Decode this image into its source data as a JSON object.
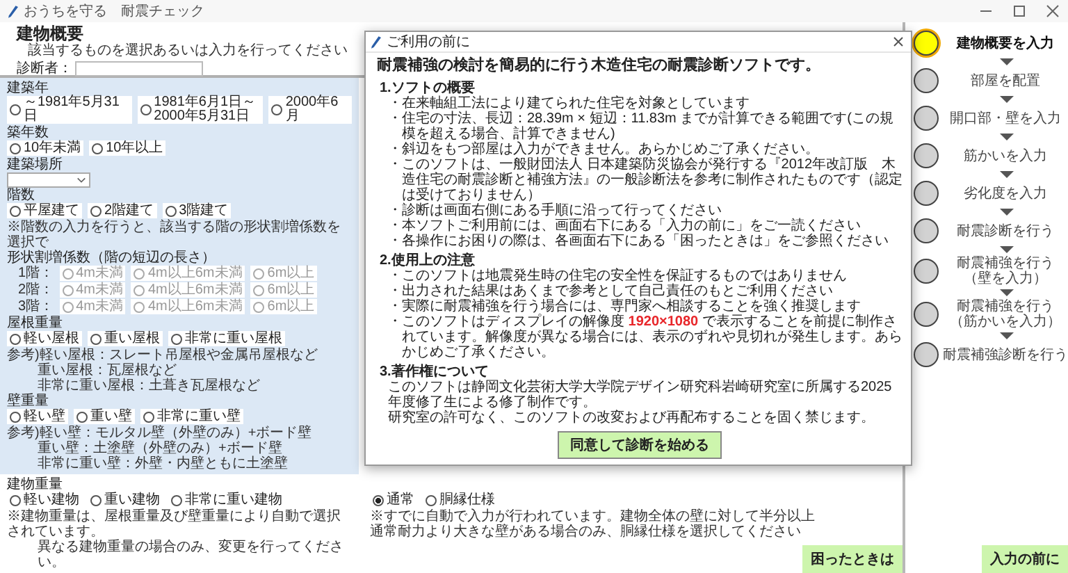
{
  "window": {
    "title": "おうちを守る　耐震チェック"
  },
  "header": {
    "title": "建物概要",
    "subtitle": "該当するものを選択あるいは入力を行ってください",
    "inspector_label": "診断者："
  },
  "form_sections": [
    {
      "kind": "highlighted",
      "groups": [
        {
          "kind": "radio",
          "label": "建築年",
          "options": [
            {
              "label": "～1981年5月31日",
              "selected": false,
              "disabled": false
            },
            {
              "label": "1981年6月1日～2000年5月31日",
              "selected": false,
              "disabled": false
            },
            {
              "label": "2000年6月",
              "selected": false,
              "disabled": false
            }
          ]
        },
        {
          "kind": "radio",
          "label": "築年数",
          "options": [
            {
              "label": "10年未満",
              "selected": false,
              "disabled": false
            },
            {
              "label": "10年以上",
              "selected": false,
              "disabled": false
            }
          ]
        },
        {
          "kind": "select",
          "label": "建築場所"
        },
        {
          "kind": "radio",
          "label": "階数",
          "options": [
            {
              "label": "平屋建て",
              "selected": false,
              "disabled": false
            },
            {
              "label": "2階建て",
              "selected": false,
              "disabled": false
            },
            {
              "label": "3階建て",
              "selected": false,
              "disabled": false
            }
          ],
          "note": [
            "※階数の入力を行うと、該当する階の形状割増係数を選択で"
          ]
        },
        {
          "kind": "grid",
          "label": "形状割増係数（階の短辺の長さ）",
          "rows": [
            {
              "label": "1階：",
              "options": [
                {
                  "label": "4m未満",
                  "selected": false,
                  "disabled": true
                },
                {
                  "label": "4m以上6m未満",
                  "selected": false,
                  "disabled": true
                },
                {
                  "label": "6m以上",
                  "selected": false,
                  "disabled": true
                }
              ]
            },
            {
              "label": "2階：",
              "options": [
                {
                  "label": "4m未満",
                  "selected": false,
                  "disabled": true
                },
                {
                  "label": "4m以上6m未満",
                  "selected": false,
                  "disabled": true
                },
                {
                  "label": "6m以上",
                  "selected": false,
                  "disabled": true
                }
              ]
            },
            {
              "label": "3階：",
              "options": [
                {
                  "label": "4m未満",
                  "selected": false,
                  "disabled": true
                },
                {
                  "label": "4m以上6m未満",
                  "selected": false,
                  "disabled": true
                },
                {
                  "label": "6m以上",
                  "selected": false,
                  "disabled": true
                }
              ]
            }
          ]
        },
        {
          "kind": "radio",
          "label": "屋根重量",
          "options": [
            {
              "label": "軽い屋根",
              "selected": false,
              "disabled": false
            },
            {
              "label": "重い屋根",
              "selected": false,
              "disabled": false
            },
            {
              "label": "非常に重い屋根",
              "selected": false,
              "disabled": false
            }
          ],
          "note": [
            "参考)軽い屋根：スレート吊屋根や金属吊屋根など",
            "重い屋根：瓦屋根など",
            "非常に重い屋根：土葺き瓦屋根など"
          ]
        },
        {
          "kind": "radio",
          "label": "壁重量",
          "options": [
            {
              "label": "軽い壁",
              "selected": false,
              "disabled": false
            },
            {
              "label": "重い壁",
              "selected": false,
              "disabled": false
            },
            {
              "label": "非常に重い壁",
              "selected": false,
              "disabled": false
            }
          ],
          "note": [
            "参考)軽い壁：モルタル壁（外壁のみ）+ボード壁",
            "重い壁：土塗壁（外壁のみ）+ボード壁",
            "非常に重い壁：外壁・内壁ともに土塗壁"
          ]
        }
      ]
    },
    {
      "kind": "plain",
      "groups": [
        {
          "kind": "radio",
          "label": "建物重量",
          "options": [
            {
              "label": "軽い建物",
              "selected": false,
              "disabled": false
            },
            {
              "label": "重い建物",
              "selected": false,
              "disabled": false
            },
            {
              "label": "非常に重い建物",
              "selected": false,
              "disabled": false
            }
          ],
          "note": [
            "※建物重量は、屋根重量及び壁重量により自動で選択されています。",
            "異なる建物重量の場合のみ、変更を行ってください。"
          ]
        }
      ]
    }
  ],
  "wall_spec": {
    "options": [
      {
        "label": "通常",
        "selected": true
      },
      {
        "label": "胴縁仕様",
        "selected": false
      }
    ],
    "note": [
      "※すでに自動で入力が行われています。建物全体の壁に対して半分以上",
      "通常耐力より大きな壁がある場合のみ、胴縁仕様を選択してください"
    ]
  },
  "help_button": "困ったときは",
  "steps": [
    {
      "lines": [
        "建物概要を入力"
      ],
      "selected": true
    },
    {
      "lines": [
        "部屋を配置"
      ],
      "selected": false
    },
    {
      "lines": [
        "開口部・壁を入力"
      ],
      "selected": false
    },
    {
      "lines": [
        "筋かいを入力"
      ],
      "selected": false
    },
    {
      "lines": [
        "劣化度を入力"
      ],
      "selected": false
    },
    {
      "lines": [
        "耐震診断を行う"
      ],
      "selected": false
    },
    {
      "lines": [
        "耐震補強を行う",
        "（壁を入力）"
      ],
      "selected": false
    },
    {
      "lines": [
        "耐震補強を行う",
        "（筋かいを入力）"
      ],
      "selected": false
    },
    {
      "lines": [
        "耐震補強診断を行う"
      ],
      "selected": false
    }
  ],
  "before_input_button": "入力の前に",
  "dialog": {
    "title": "ご利用の前に",
    "heading": "耐震補強の検討を簡易的に行う木造住宅の耐震診断ソフトです。",
    "sections": [
      {
        "title": "1.ソフトの概要",
        "kind": "bullets",
        "items": [
          {
            "parts": [
              {
                "text": "・在来軸組工法により建てられた住宅を対象としています",
                "highlight": false
              }
            ]
          },
          {
            "parts": [
              {
                "text": "・住宅の寸法、長辺：28.39m × 短辺：11.83m までが計算できる範囲です(この規模を超える場合、計算できません)",
                "highlight": false
              }
            ]
          },
          {
            "parts": [
              {
                "text": "・斜辺をもつ部屋は入力ができません。あらかじめご了承ください。",
                "highlight": false
              }
            ]
          },
          {
            "parts": [
              {
                "text": "・このソフトは、一般財団法人 日本建築防災協会が発行する『2012年改訂版　木造住宅の耐震診断と補強方法』の一般診断法を参考に制作されたものです（認定は受けておりません）",
                "highlight": false
              }
            ]
          },
          {
            "parts": [
              {
                "text": "・診断は画面右側にある手順に沿って行ってください",
                "highlight": false
              }
            ]
          },
          {
            "parts": [
              {
                "text": "・本ソフトご利用前には、画面右下にある「入力の前に」をご一読ください",
                "highlight": false
              }
            ]
          },
          {
            "parts": [
              {
                "text": "・各操作にお困りの際は、各画面右下にある「困ったときは」をご参照ください",
                "highlight": false
              }
            ]
          }
        ]
      },
      {
        "title": "2.使用上の注意",
        "kind": "bullets",
        "items": [
          {
            "parts": [
              {
                "text": "・このソフトは地震発生時の住宅の安全性を保証するものではありません",
                "highlight": false
              }
            ]
          },
          {
            "parts": [
              {
                "text": "・出力された結果はあくまで参考として自己責任のもとご利用ください",
                "highlight": false
              }
            ]
          },
          {
            "parts": [
              {
                "text": "・実際に耐震補強を行う場合には、専門家へ相談することを強く推奨します",
                "highlight": false
              }
            ]
          },
          {
            "parts": [
              {
                "text": "・このソフトはディスプレイの解像度 ",
                "highlight": false
              },
              {
                "text": "1920×1080",
                "highlight": true
              },
              {
                "text": " で表示することを前提に制作されています。解像度が異なる場合には、表示のずれや見切れが発生します。あらかじめご了承ください。",
                "highlight": false
              }
            ]
          }
        ]
      },
      {
        "title": "3.著作権について",
        "kind": "paragraphs",
        "items": [
          {
            "parts": [
              {
                "text": "このソフトは静岡文化芸術大学大学院デザイン研究科岩崎研究室に所属する2025年度修了生による修了制作です。",
                "highlight": false
              }
            ]
          },
          {
            "parts": [
              {
                "text": "研究室の許可なく、このソフトの改変および再配布することを固く禁じます。",
                "highlight": false
              }
            ]
          }
        ]
      }
    ],
    "button": "同意して診断を始める"
  }
}
